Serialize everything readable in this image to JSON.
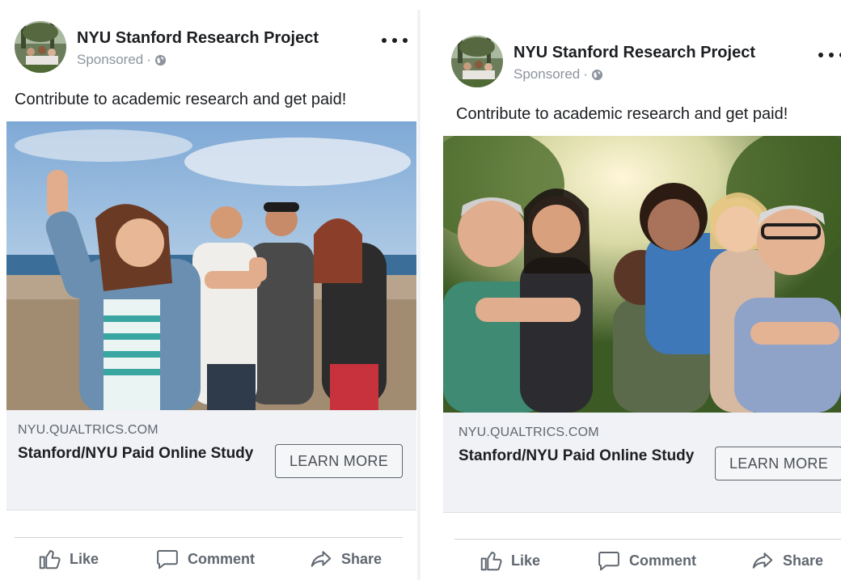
{
  "posts": [
    {
      "page_name": "NYU Stanford Research Project",
      "sponsored": "Sponsored",
      "separator": "·",
      "text": "Contribute to academic research and get paid!",
      "link": {
        "domain": "NYU.QUALTRICS.COM",
        "title": "Stanford/NYU Paid Online Study",
        "cta": "LEARN MORE"
      },
      "actions": {
        "like": "Like",
        "comment": "Comment",
        "share": "Share"
      }
    },
    {
      "page_name": "NYU Stanford Research Project",
      "sponsored": "Sponsored",
      "separator": "·",
      "text": "Contribute to academic research and get paid!",
      "link": {
        "domain": "NYU.QUALTRICS.COM",
        "title": "Stanford/NYU Paid Online Study",
        "cta": "LEARN MORE"
      },
      "actions": {
        "like": "Like",
        "comment": "Comment",
        "share": "Share"
      }
    }
  ],
  "icons": [
    "globe-icon",
    "more-options-icon",
    "like-icon",
    "comment-icon",
    "share-icon"
  ],
  "colors": {
    "secondary_text": "#606770",
    "link_bg": "#f0f2f5",
    "meta_text": "#8d949e"
  }
}
